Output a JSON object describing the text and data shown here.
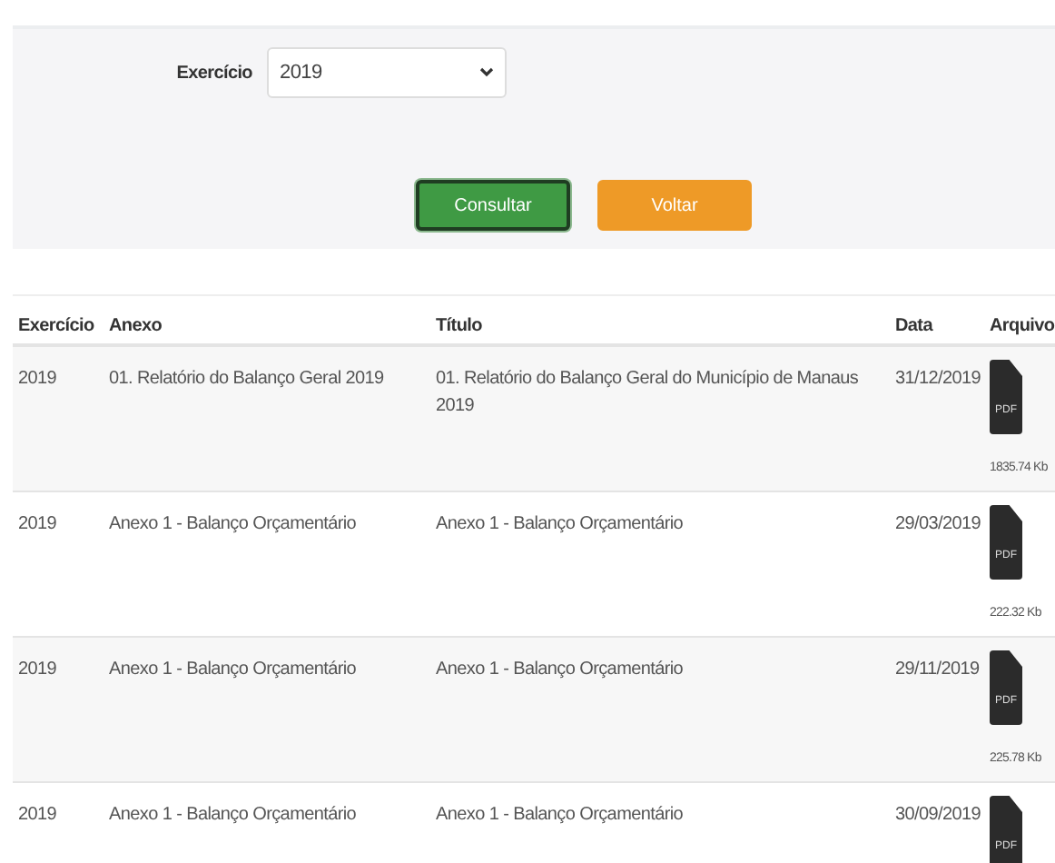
{
  "filter": {
    "label": "Exercício",
    "value": "2019"
  },
  "buttons": [
    {
      "label": "Consultar",
      "kind": "primary"
    },
    {
      "label": "Voltar",
      "kind": "back"
    }
  ],
  "table": {
    "columns": [
      "Exercício",
      "Anexo",
      "Título",
      "Data",
      "Arquivo"
    ],
    "rows": [
      {
        "exercicio": "2019",
        "anexo": "01. Relatório do Balanço Geral 2019",
        "titulo": "01. Relatório do Balanço Geral do Município de Manaus 2019",
        "data": "31/12/2019",
        "file_label": "PDF",
        "size": "1835.74 Kb"
      },
      {
        "exercicio": "2019",
        "anexo": "Anexo 1 - Balanço Orçamentário",
        "titulo": "Anexo 1 - Balanço Orçamentário",
        "data": "29/03/2019",
        "file_label": "PDF",
        "size": "222.32 Kb"
      },
      {
        "exercicio": "2019",
        "anexo": "Anexo 1 - Balanço Orçamentário",
        "titulo": "Anexo 1 - Balanço Orçamentário",
        "data": "29/11/2019",
        "file_label": "PDF",
        "size": "225.78 Kb"
      },
      {
        "exercicio": "2019",
        "anexo": "Anexo 1 - Balanço Orçamentário",
        "titulo": "Anexo 1 - Balanço Orçamentário",
        "data": "30/09/2019",
        "file_label": "PDF"
      }
    ]
  }
}
